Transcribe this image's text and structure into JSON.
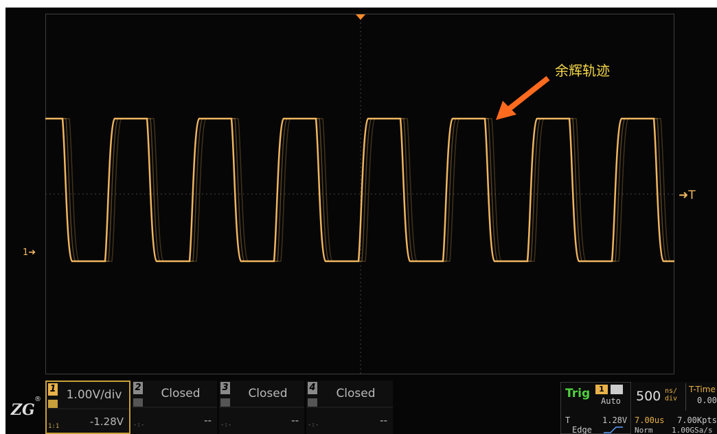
{
  "annotation": {
    "label": "余辉轨迹"
  },
  "markers": {
    "ch1": "1",
    "trigger": "T"
  },
  "channels": [
    {
      "num": "1",
      "scale": "1.00V/div",
      "offset": "-1.28V",
      "coupling": "1:1"
    },
    {
      "num": "2",
      "scale": "Closed",
      "offset": "--",
      "coupling": "-:-"
    },
    {
      "num": "3",
      "scale": "Closed",
      "offset": "--",
      "coupling": "-:-"
    },
    {
      "num": "4",
      "scale": "Closed",
      "offset": "--",
      "coupling": "-:-"
    }
  ],
  "trigger": {
    "title": "Trig",
    "source": "1",
    "mode": "Auto",
    "label": "T",
    "level": "1.28V",
    "type": "Edge"
  },
  "timebase": {
    "scale": "500",
    "unit_top": "ns/",
    "unit_bottom": "div",
    "mode": "T-Time",
    "offset": "0.00",
    "delay": "7.00us",
    "memory": "7.00Kpts",
    "acquire": "Norm",
    "sample_rate": "1.00GSa/s"
  },
  "colors": {
    "trace": "#f0b660",
    "annotation_text": "#f5d84a",
    "arrow": "#ff6a1f",
    "trig_label": "#50d040"
  }
}
